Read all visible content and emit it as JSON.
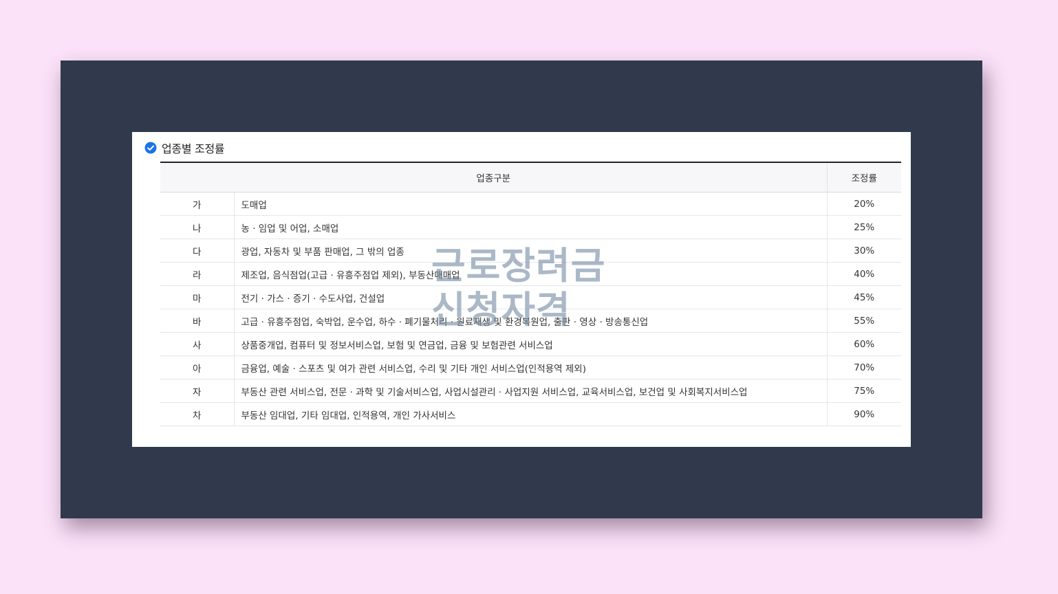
{
  "section": {
    "title": "업종별 조정률",
    "icon": "check-circle-icon"
  },
  "table": {
    "headers": {
      "category": "업종구분",
      "rate": "조정률"
    },
    "rows": [
      {
        "code": "가",
        "industry": "도매업",
        "rate": "20%"
      },
      {
        "code": "나",
        "industry": "농 · 임업 및 어업, 소매업",
        "rate": "25%"
      },
      {
        "code": "다",
        "industry": "광업, 자동차 및 부품 판매업, 그 밖의 업종",
        "rate": "30%"
      },
      {
        "code": "라",
        "industry": "제조업, 음식점업(고급 · 유흥주점업 제외), 부동산매매업",
        "rate": "40%"
      },
      {
        "code": "마",
        "industry": "전기 · 가스 · 증기 · 수도사업, 건설업",
        "rate": "45%"
      },
      {
        "code": "바",
        "industry": "고급 · 유흥주점업, 숙박업, 운수업, 하수 · 폐기물처리 · 원료재생 및 환경복원업, 출판 · 영상 · 방송통신업",
        "rate": "55%"
      },
      {
        "code": "사",
        "industry": "상품중개업, 컴퓨터 및 정보서비스업, 보험 및 연금업, 금융 및 보험관련 서비스업",
        "rate": "60%"
      },
      {
        "code": "아",
        "industry": "금융업, 예술 · 스포츠 및 여가 관련 서비스업, 수리 및 기타 개인 서비스업(인적용역 제외)",
        "rate": "70%"
      },
      {
        "code": "자",
        "industry": "부동산 관련 서비스업, 전문 · 과학 및 기술서비스업, 사업시설관리 · 사업지원 서비스업, 교육서비스업, 보건업 및 사회복지서비스업",
        "rate": "75%"
      },
      {
        "code": "차",
        "industry": "부동산 임대업, 기타 임대업, 인적용역, 개인 가사서비스",
        "rate": "90%"
      }
    ]
  },
  "watermark": {
    "line1": "근로장려금",
    "line2": "신청자격"
  },
  "colors": {
    "page_background": "#fbe2f8",
    "frame": "#303a4c",
    "accent_check": "#1a73e8",
    "watermark": "#788ca5"
  }
}
